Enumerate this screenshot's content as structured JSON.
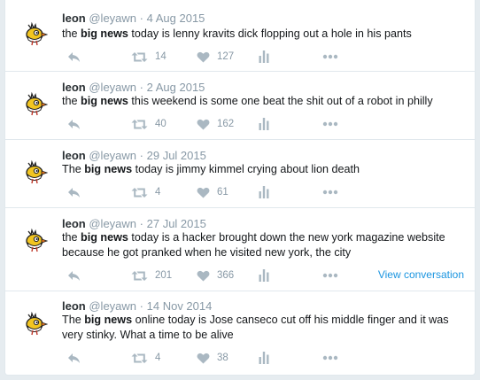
{
  "colors": {
    "page_bg": "#e6ecf0",
    "name": "#292f33",
    "meta": "#8899a6",
    "icon": "#aab8c2",
    "link": "#1b95e0"
  },
  "icons": [
    "bird-avatar-icon",
    "reply-icon",
    "retweet-icon",
    "heart-icon",
    "analytics-icon",
    "more-icon"
  ],
  "tweets": [
    {
      "name": "leon",
      "handle": "@leyawn",
      "sep": "·",
      "date": "4 Aug 2015",
      "text_pre": "the ",
      "text_bold": "big news",
      "text_post": " today is lenny kravits dick flopping out a hole in his pants",
      "retweets": "14",
      "likes": "127"
    },
    {
      "name": "leon",
      "handle": "@leyawn",
      "sep": "·",
      "date": "2 Aug 2015",
      "text_pre": "the ",
      "text_bold": "big news",
      "text_post": " this weekend is some one beat the shit out of a robot in philly",
      "retweets": "40",
      "likes": "162"
    },
    {
      "name": "leon",
      "handle": "@leyawn",
      "sep": "·",
      "date": "29 Jul 2015",
      "text_pre": "The ",
      "text_bold": "big news",
      "text_post": " today is jimmy kimmel crying about lion death",
      "retweets": "4",
      "likes": "61"
    },
    {
      "name": "leon",
      "handle": "@leyawn",
      "sep": "·",
      "date": "27 Jul 2015",
      "text_pre": "the ",
      "text_bold": "big news",
      "text_post": " today is a hacker brought down the new york magazine website because he got pranked when he visited new york, the city",
      "retweets": "201",
      "likes": "366",
      "view_conversation": "View conversation"
    },
    {
      "name": "leon",
      "handle": "@leyawn",
      "sep": "·",
      "date": "14 Nov 2014",
      "text_pre": "The ",
      "text_bold": "big news",
      "text_post": " online today is Jose canseco cut off his middle finger and it was very stinky. What a time to be alive",
      "retweets": "4",
      "likes": "38"
    }
  ]
}
